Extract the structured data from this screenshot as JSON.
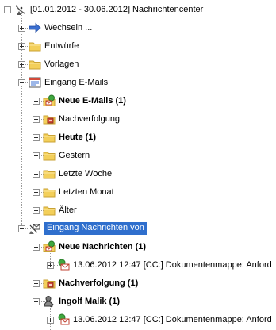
{
  "tree": {
    "nodes": [
      {
        "label": "[01.01.2012 - 30.06.2012] Nachrichtencenter",
        "icon": "satellite-dish-icon",
        "bold": false,
        "toggle": "minus"
      },
      {
        "label": "Wechseln ...",
        "icon": "arrow-right-icon",
        "bold": false,
        "toggle": "plus"
      },
      {
        "label": "Entwürfe",
        "icon": "folder-icon",
        "bold": false,
        "toggle": "plus"
      },
      {
        "label": "Vorlagen",
        "icon": "folder-icon",
        "bold": false,
        "toggle": "plus"
      },
      {
        "label": "Eingang  E-Mails",
        "icon": "inbox-email-icon",
        "bold": false,
        "toggle": "minus"
      },
      {
        "label": "Neue E-Mails (1)",
        "icon": "folder-new-mail-icon",
        "bold": true,
        "toggle": "plus"
      },
      {
        "label": "Nachverfolgung",
        "icon": "folder-followup-icon",
        "bold": false,
        "toggle": "plus"
      },
      {
        "label": "Heute (1)",
        "icon": "folder-icon",
        "bold": true,
        "toggle": "plus"
      },
      {
        "label": "Gestern",
        "icon": "folder-icon",
        "bold": false,
        "toggle": "plus"
      },
      {
        "label": "Letzte Woche",
        "icon": "folder-icon",
        "bold": false,
        "toggle": "plus"
      },
      {
        "label": "Letzten Monat",
        "icon": "folder-icon",
        "bold": false,
        "toggle": "plus"
      },
      {
        "label": "Älter",
        "icon": "folder-icon",
        "bold": false,
        "toggle": "plus"
      },
      {
        "label": "Eingang Nachrichten von",
        "icon": "inbox-messages-icon",
        "bold": false,
        "toggle": "minus",
        "selected": true
      },
      {
        "label": "Neue Nachrichten (1)",
        "icon": "folder-new-mail-icon",
        "bold": true,
        "toggle": "minus"
      },
      {
        "label": "13.06.2012 12:47 [CC:] Dokumentenmappe: Anford",
        "icon": "message-unread-icon",
        "bold": false,
        "toggle": "plus"
      },
      {
        "label": "Nachverfolgung (1)",
        "icon": "folder-followup-icon",
        "bold": true,
        "toggle": "plus"
      },
      {
        "label": "Ingolf Malik (1)",
        "icon": "contact-person-icon",
        "bold": true,
        "toggle": "minus"
      },
      {
        "label": "13.06.2012 12:47 [CC:] Dokumentenmappe: Anford",
        "icon": "message-unread-icon",
        "bold": false,
        "toggle": "plus"
      }
    ]
  },
  "colors": {
    "selection": "#2f6fcd",
    "folder": "#f3cf5a",
    "folder_edge": "#c9a233",
    "dotted_lines": "#9a9a9a",
    "arrow_blue": "#3b6fd0"
  }
}
